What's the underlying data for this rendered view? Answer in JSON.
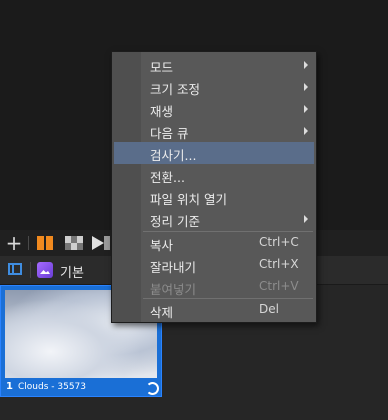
{
  "toolbar": {
    "add_label": "+"
  },
  "panel": {
    "bin_label": "기본"
  },
  "clip": {
    "number": "1",
    "name": "Clouds - 35573"
  },
  "menu": {
    "items": [
      {
        "label": "모드",
        "shortcut": "",
        "submenu": true,
        "disabled": false,
        "highlighted": false
      },
      {
        "label": "크기 조정",
        "shortcut": "",
        "submenu": true,
        "disabled": false,
        "highlighted": false
      },
      {
        "label": "재생",
        "shortcut": "",
        "submenu": true,
        "disabled": false,
        "highlighted": false
      },
      {
        "label": "다음 큐",
        "shortcut": "",
        "submenu": true,
        "disabled": false,
        "highlighted": false
      },
      {
        "label": "검사기...",
        "shortcut": "",
        "submenu": false,
        "disabled": false,
        "highlighted": true
      },
      {
        "label": "전환...",
        "shortcut": "",
        "submenu": false,
        "disabled": false,
        "highlighted": false
      },
      {
        "label": "파일 위치 열기",
        "shortcut": "",
        "submenu": false,
        "disabled": false,
        "highlighted": false
      },
      {
        "label": "정리 기준",
        "shortcut": "",
        "submenu": true,
        "disabled": false,
        "highlighted": false
      },
      {
        "label": "복사",
        "shortcut": "Ctrl+C",
        "submenu": false,
        "disabled": false,
        "highlighted": false
      },
      {
        "label": "잘라내기",
        "shortcut": "Ctrl+X",
        "submenu": false,
        "disabled": false,
        "highlighted": false
      },
      {
        "label": "붙여넣기",
        "shortcut": "Ctrl+V",
        "submenu": false,
        "disabled": true,
        "highlighted": false
      },
      {
        "label": "삭제",
        "shortcut": "Del",
        "submenu": false,
        "disabled": false,
        "highlighted": false
      }
    ]
  },
  "colors": {
    "accent_orange": "#f18a1f",
    "accent_blue": "#1a6fd6",
    "menu_highlight": "#5a6d8a"
  }
}
